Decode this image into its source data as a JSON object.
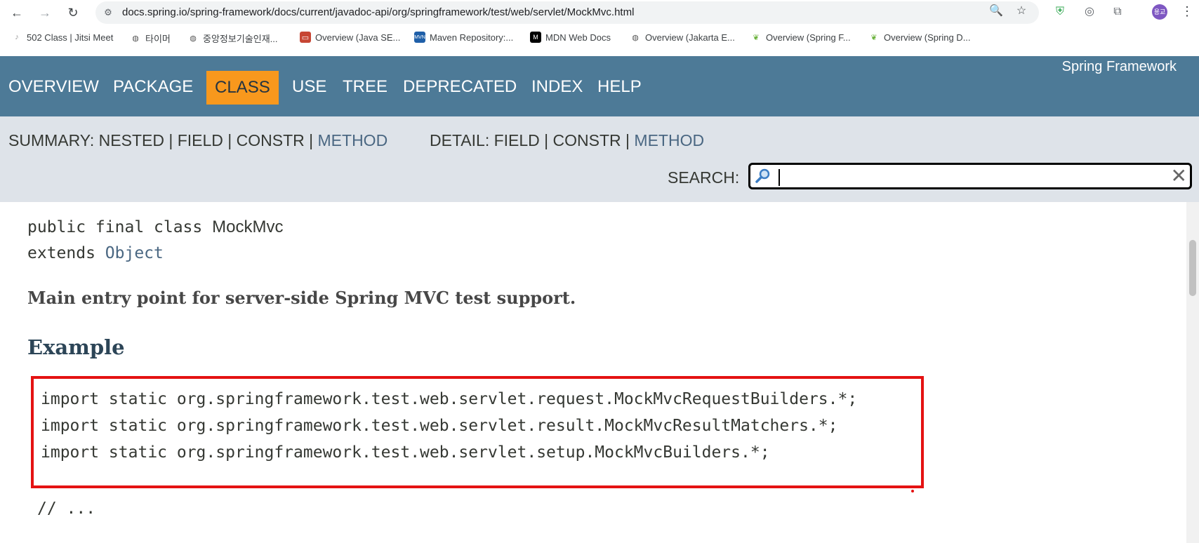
{
  "browser": {
    "url": "docs.spring.io/spring-framework/docs/current/javadoc-api/org/springframework/test/web/servlet/MockMvc.html",
    "avatar_text": "용교",
    "bookmarks": [
      {
        "label": "502 Class | Jitsi Meet",
        "icon": "jitsi-icon"
      },
      {
        "label": "타이머",
        "icon": "globe-icon"
      },
      {
        "label": "중앙정보기술인재...",
        "icon": "globe-icon"
      },
      {
        "label": "Overview (Java SE...",
        "icon": "oracle-icon"
      },
      {
        "label": "Maven Repository:...",
        "icon": "mvn-icon"
      },
      {
        "label": "MDN Web Docs",
        "icon": "mdn-icon"
      },
      {
        "label": "Overview (Jakarta E...",
        "icon": "globe-icon"
      },
      {
        "label": "Overview (Spring F...",
        "icon": "spring-icon"
      },
      {
        "label": "Overview (Spring D...",
        "icon": "spring-icon"
      }
    ]
  },
  "topnav": {
    "items": [
      "OVERVIEW",
      "PACKAGE",
      "CLASS",
      "USE",
      "TREE",
      "DEPRECATED",
      "INDEX",
      "HELP"
    ],
    "active": "CLASS",
    "brand": "Spring Framework"
  },
  "subnav": {
    "summary_label": "SUMMARY: NESTED | FIELD | CONSTR | ",
    "summary_method": "METHOD",
    "detail_label": "DETAIL: FIELD | CONSTR | ",
    "detail_method": "METHOD",
    "search_label": "SEARCH:",
    "search_value": ""
  },
  "content": {
    "sig_prefix": "public final class ",
    "class_name": "MockMvc",
    "extends_prefix": "extends ",
    "extends_class": "Object",
    "summary": "Main entry point for server-side Spring MVC test support.",
    "example_heading": "Example",
    "code_lines": [
      "import static org.springframework.test.web.servlet.request.MockMvcRequestBuilders.*;",
      "import static org.springframework.test.web.servlet.result.MockMvcResultMatchers.*;",
      "import static org.springframework.test.web.servlet.setup.MockMvcBuilders.*;"
    ],
    "comment": "// ..."
  },
  "colors": {
    "nav_bg": "#4d7a97",
    "active_tab": "#f8981d",
    "subnav_bg": "#dee3e9",
    "highlight_box": "#e41212"
  }
}
